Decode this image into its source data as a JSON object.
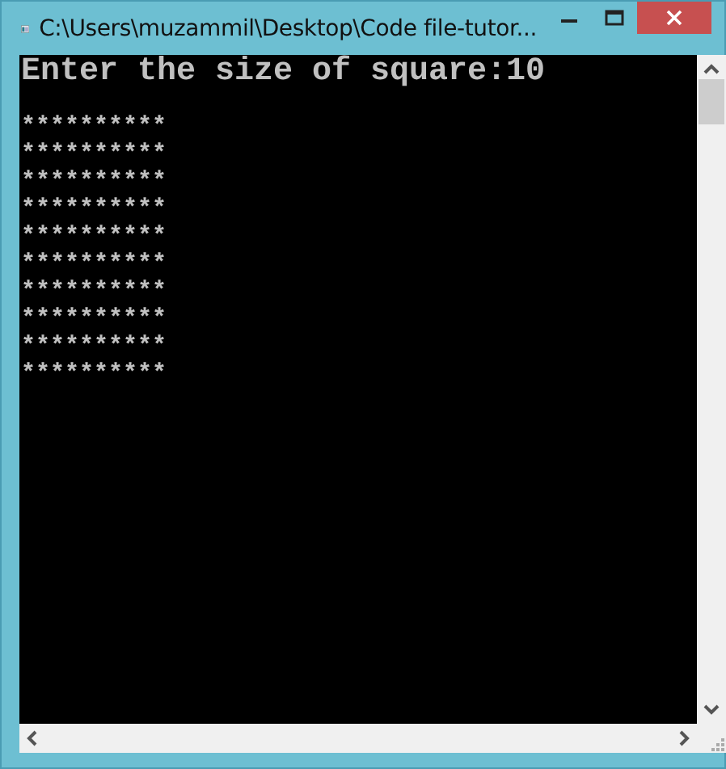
{
  "window": {
    "title": "C:\\Users\\muzammil\\Desktop\\Code file-tutor..."
  },
  "console": {
    "prompt": "Enter the size of square:10",
    "rows": [
      "**********",
      "**********",
      "**********",
      "**********",
      "**********",
      "**********",
      "**********",
      "**********",
      "**********",
      "**********"
    ]
  }
}
